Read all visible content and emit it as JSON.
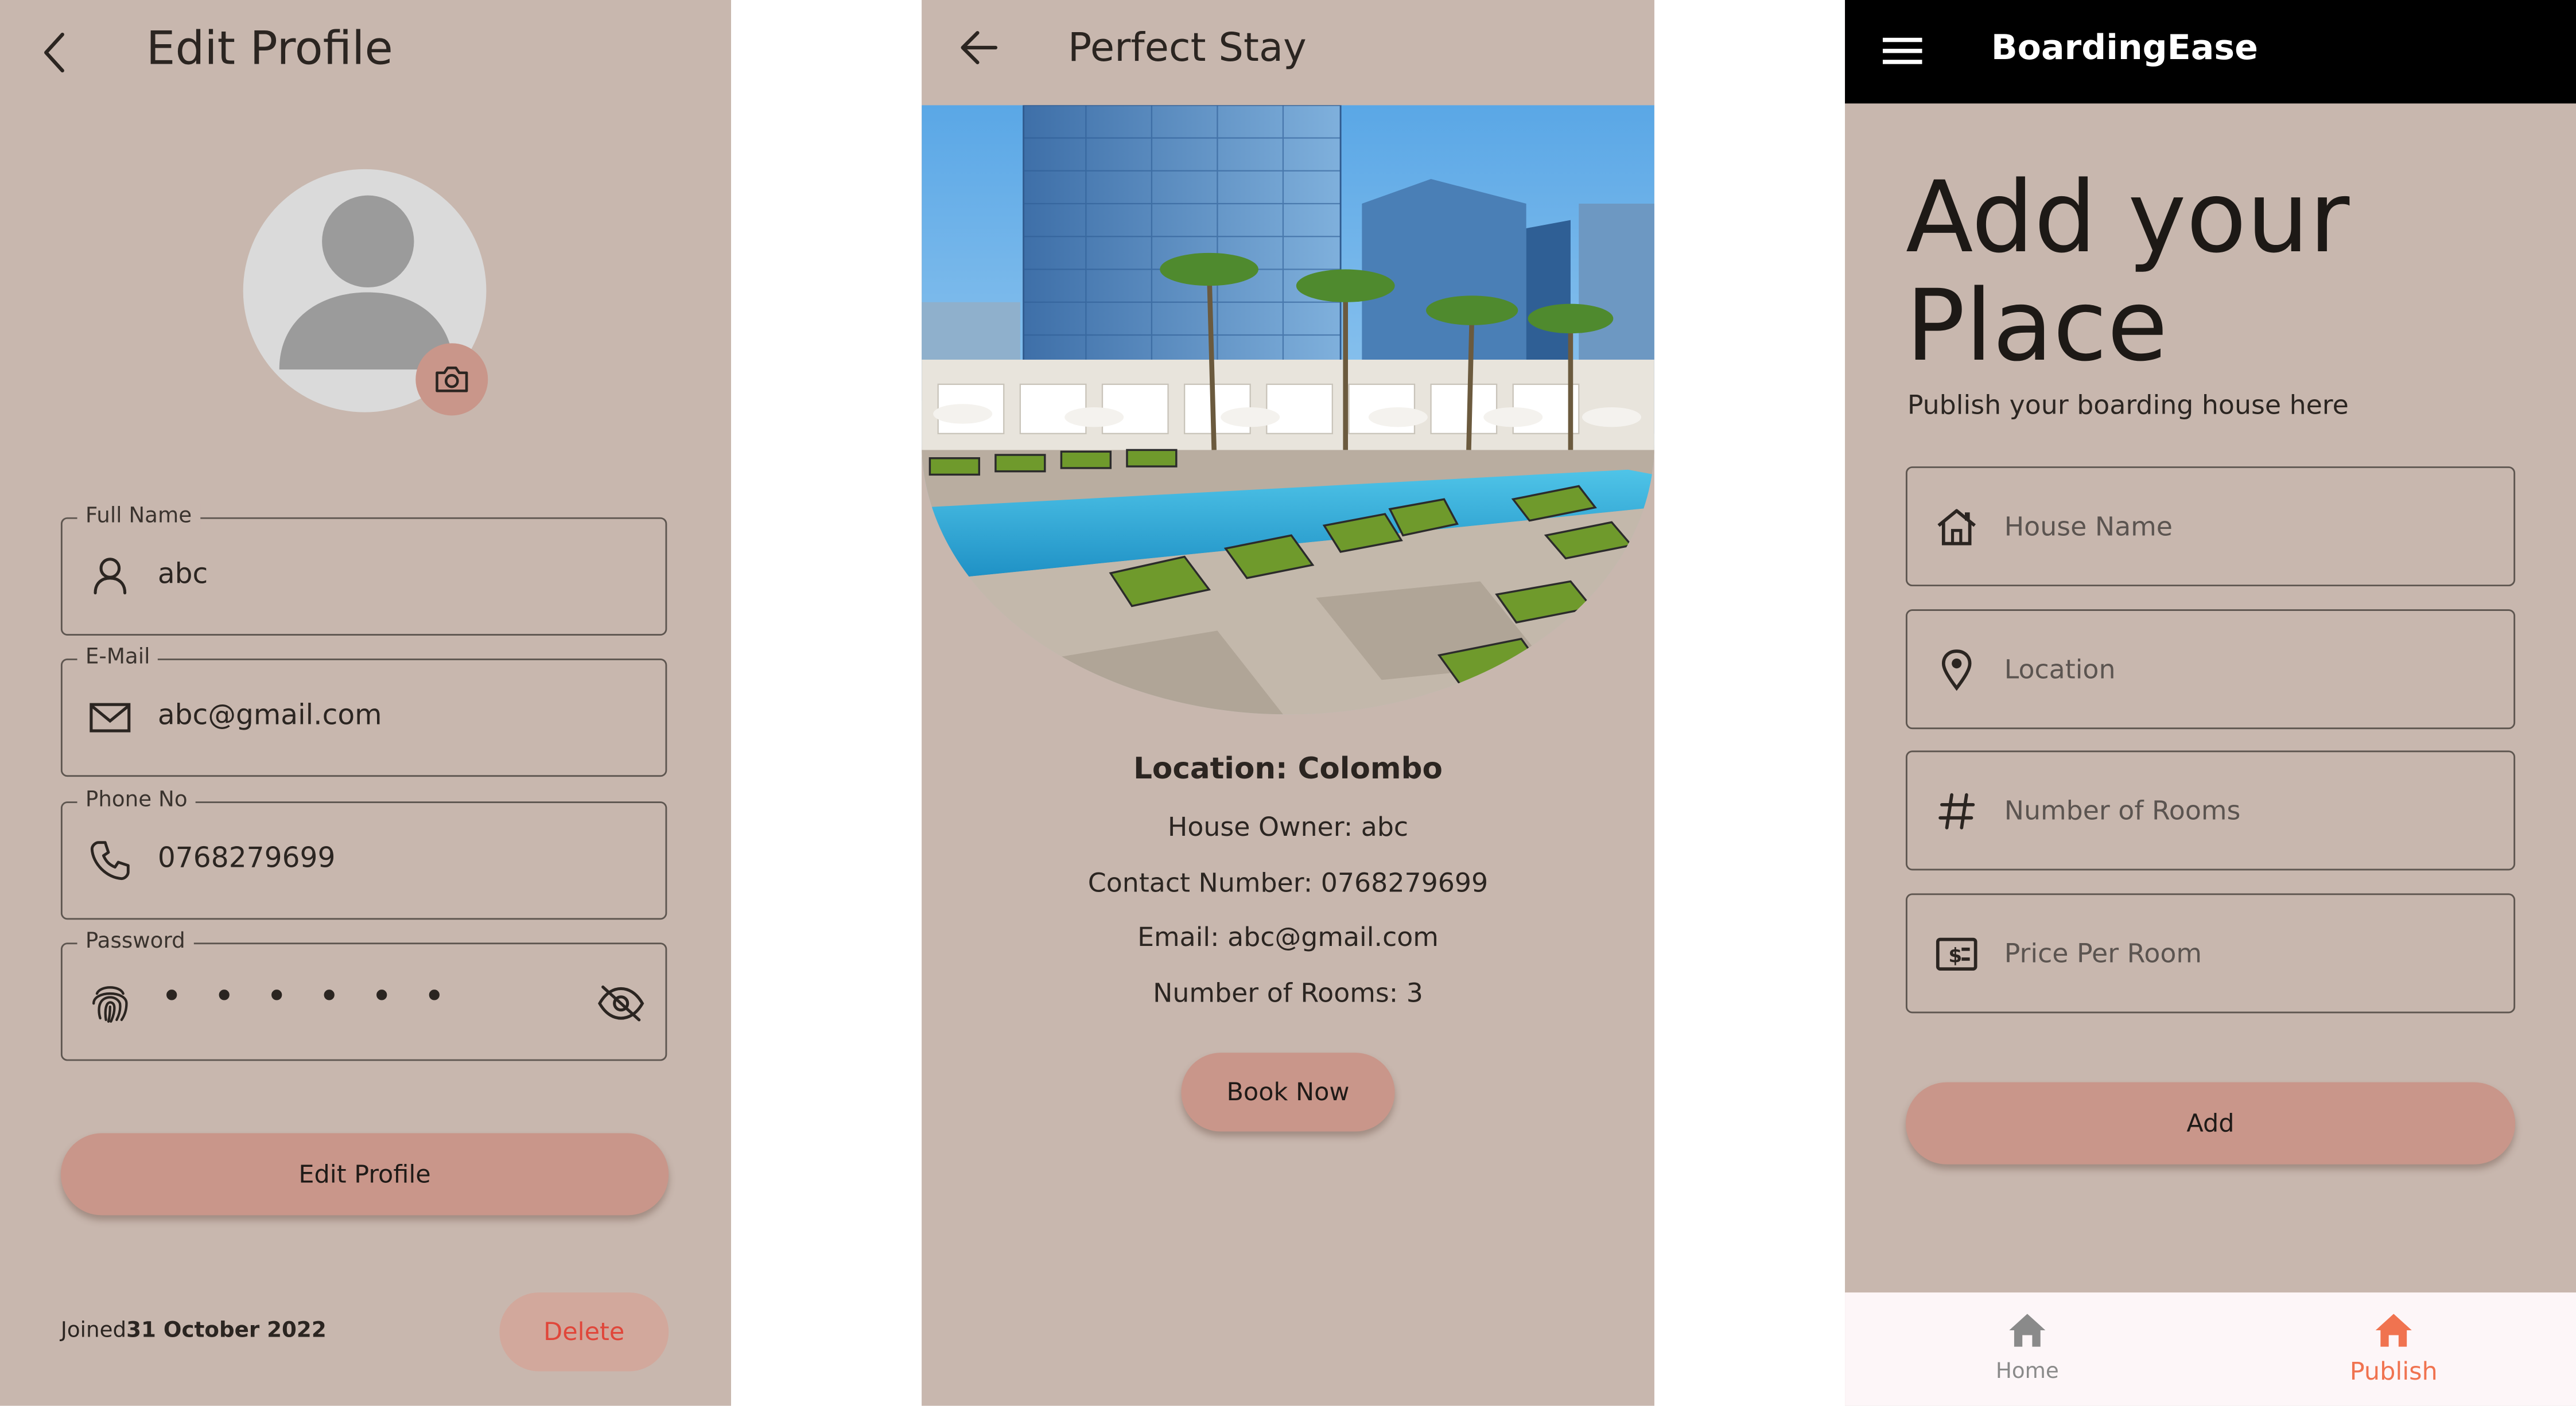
{
  "edit_profile": {
    "title": "Edit Profile",
    "fields": [
      {
        "label": "Full Name",
        "value": "abc"
      },
      {
        "label": "E-Mail",
        "value": "abc@gmail.com"
      },
      {
        "label": "Phone No",
        "value": "0768279699"
      },
      {
        "label": "Password",
        "value": "• • • • • •"
      }
    ],
    "edit_button": "Edit Profile",
    "joined_label": "Joined",
    "joined_date": "31 October 2022",
    "delete_button": "Delete"
  },
  "listing": {
    "title": "Perfect Stay",
    "location": "Location: Colombo",
    "owner": "House Owner: abc",
    "contact": "Contact Number: 0768279699",
    "email": "Email: abc@gmail.com",
    "rooms": "Number of Rooms: 3",
    "book_button": "Book Now"
  },
  "add_place": {
    "brand": "BoardingEase",
    "title_line1": "Add your",
    "title_line2": "Place",
    "subtitle": "Publish your boarding house here",
    "fields": [
      {
        "placeholder": "House Name",
        "icon": "house-icon"
      },
      {
        "placeholder": "Location",
        "icon": "location-pin-icon"
      },
      {
        "placeholder": "Number of Rooms",
        "icon": "hash-icon"
      },
      {
        "placeholder": "Price Per Room",
        "icon": "price-tag-icon"
      }
    ],
    "add_button": "Add",
    "nav": [
      {
        "label": "Home",
        "icon": "home-icon",
        "active": false
      },
      {
        "label": "Publish",
        "icon": "home-icon",
        "active": true
      }
    ]
  },
  "colors": {
    "background": "#c8b7ae",
    "button": "#c9968a",
    "delete_text": "#e0463a",
    "nav_active": "#f07350",
    "nav_inactive": "#8a8a8a",
    "app_bar_dark": "#000000"
  }
}
